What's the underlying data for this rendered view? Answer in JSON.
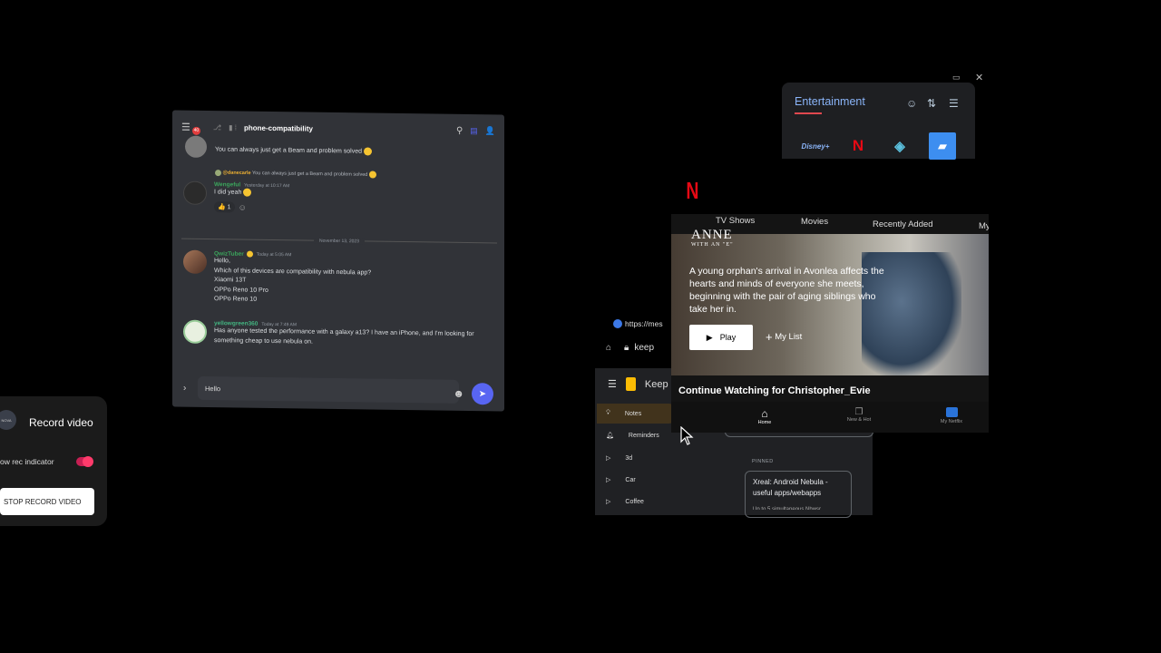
{
  "discord": {
    "notification_count": "40",
    "channel": "phone-compatibility",
    "msg0_text": "You can always just get a Beam and problem solved",
    "reply_user": "@danecarle",
    "reply_text": "You can always just get a Beam and problem solved",
    "msg1_user": "Wengeful",
    "msg1_time": "Yesterday at 10:17 AM",
    "msg1_text": "I did yeah",
    "reaction_count": "1",
    "date_divider": "November 13, 2023",
    "msg2_user": "QwizTuber",
    "msg2_time": "Today at 5:05 AM",
    "msg2_lines": [
      "Hello,",
      "Which of this devices are compatibility with nebula app?",
      "Xiaomi 13T",
      "OPPo Reno 10 Pro",
      "OPPo Reno 10"
    ],
    "msg3_user": "yellowgreen360",
    "msg3_time": "Today at 7:49 AM",
    "msg3_text": "Has anyone tested the performance with a galaxy a13? I have an iPhone, and I'm looking for something cheap to use nebula on.",
    "input_value": "Hello",
    "colors": {
      "bg": "#313338",
      "accent": "#5865f2",
      "user1": "#3ba55c",
      "user2": "#43b581"
    }
  },
  "record": {
    "title": "Record video",
    "indicator_label": "ow rec indicator",
    "stop_label": "STOP RECORD VIDEO",
    "logo_text": "NOVA",
    "indicator_on": true
  },
  "entertainment": {
    "title": "Entertainment",
    "apps": [
      "disney-plus-icon",
      "netflix-icon",
      "kodi-icon",
      "folder-app-icon"
    ]
  },
  "window_controls": [
    "minimize-icon",
    "close-icon"
  ],
  "browser": {
    "url_fragment": "https://mes",
    "keep_label": "keep"
  },
  "keep": {
    "app_name": "Keep",
    "sidebar": [
      "Notes",
      "Reminders",
      "3d",
      "Car",
      "Coffee"
    ],
    "pinned_label": "PINNED",
    "pinned_note_title": "Xreal: Android Nebula - useful apps/webapps",
    "pinned_note_preview": "Up to 5 simultaneous Nbwsr"
  },
  "netflix": {
    "logo": "N",
    "nav": [
      "TV Shows",
      "Movies",
      "Recently Added",
      "My"
    ],
    "show_title_line1": "ANNE",
    "show_title_line2": "WITH AN \"E\"",
    "description": "A young orphan's arrival in Avonlea affects the hearts and minds of everyone she meets, beginning with the pair of aging siblings who take her in.",
    "play_label": "Play",
    "mylist_label": "My List",
    "continue_watching": "Continue Watching for Christopher_Evie",
    "tabs": [
      "Home",
      "New & Hot",
      "My Netflix"
    ]
  }
}
